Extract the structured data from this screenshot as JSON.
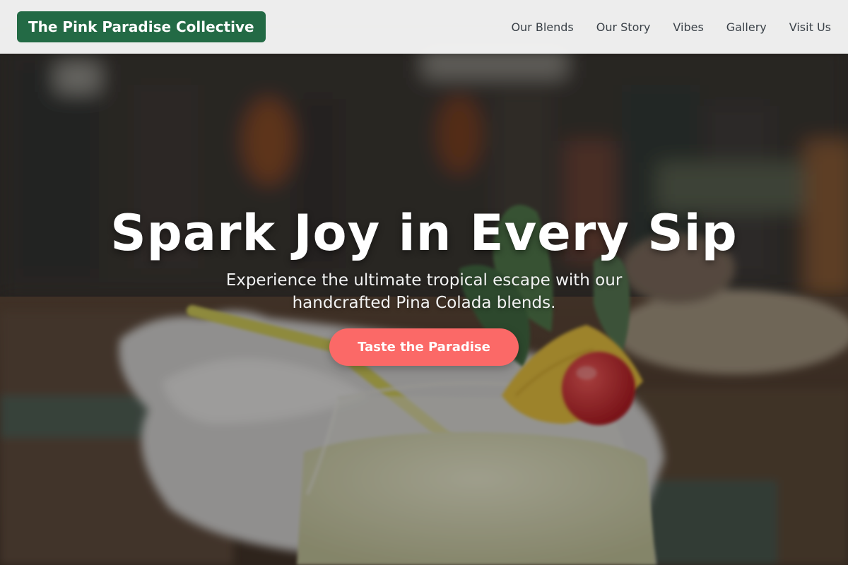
{
  "brand": {
    "name": "The Pink Paradise Collective",
    "color": "#236a45"
  },
  "nav": {
    "items": [
      {
        "label": "Our Blends"
      },
      {
        "label": "Our Story"
      },
      {
        "label": "Vibes"
      },
      {
        "label": "Gallery"
      },
      {
        "label": "Visit Us"
      }
    ]
  },
  "hero": {
    "title": "Spark Joy in Every Sip",
    "subtitle": "Experience the ultimate tropical escape with our handcrafted Pina Colada blends.",
    "cta_label": "Taste the Paradise",
    "cta_color": "#fb6967"
  }
}
